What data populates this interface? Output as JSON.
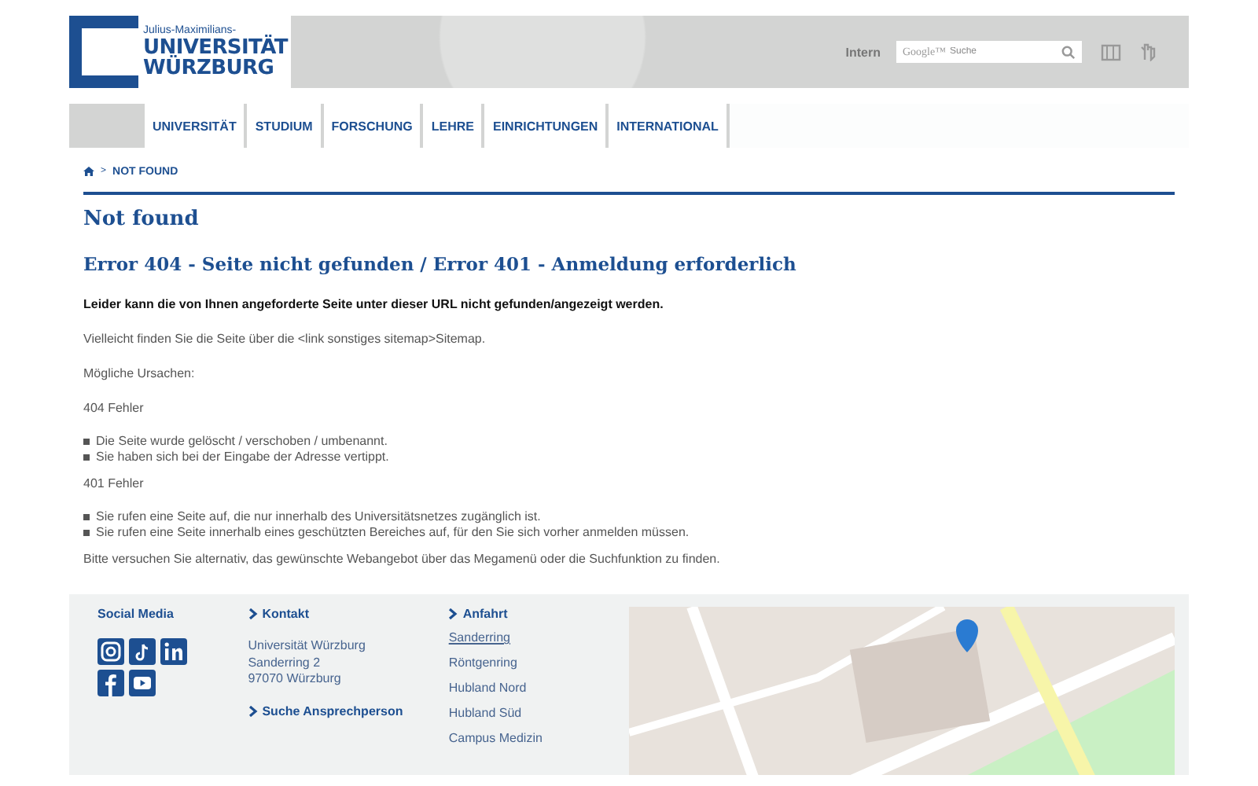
{
  "header": {
    "logo": {
      "small": "Julius-Maximilians-",
      "line1": "UNIVERSITÄT",
      "line2": "WÜRZBURG"
    },
    "intern": "Intern",
    "search": {
      "brand": "Google™",
      "placeholder": "Suche"
    }
  },
  "nav": [
    "UNIVERSITÄT",
    "STUDIUM",
    "FORSCHUNG",
    "LEHRE",
    "EINRICHTUNGEN",
    "INTERNATIONAL"
  ],
  "breadcrumb": [
    {
      "separator": ">",
      "label": "NOT FOUND"
    }
  ],
  "title": "Not found",
  "subtitle": "Error 404 - Seite nicht gefunden / Error 401 - Anmeldung erforderlich",
  "content": [
    {
      "kind": "bold",
      "text": "Leider kann die von Ihnen angeforderte Seite unter dieser URL nicht gefunden/angezeigt werden."
    },
    {
      "kind": "para",
      "text": "Vielleicht finden Sie die Seite über die <link sonstiges sitemap>Sitemap."
    },
    {
      "kind": "para",
      "text": "Mögliche Ursachen:"
    },
    {
      "kind": "para",
      "text": "404 Fehler"
    },
    {
      "kind": "list",
      "items": [
        "Die Seite wurde gelöscht / verschoben / umbenannt.",
        "Sie haben sich bei der Eingabe der Adresse vertippt."
      ]
    },
    {
      "kind": "para",
      "text": "401 Fehler"
    },
    {
      "kind": "list",
      "items": [
        "Sie rufen eine Seite auf, die nur innerhalb des Universitätsnetzes zugänglich ist.",
        "Sie rufen eine Seite innerhalb eines geschützten Bereiches auf, für den Sie sich vorher anmelden müssen."
      ]
    },
    {
      "kind": "para",
      "text": "Bitte versuchen Sie alternativ, das gewünschte Webangebot über das Megamenü oder die Suchfunktion zu finden."
    }
  ],
  "footer": {
    "social": {
      "title": "Social Media",
      "icons": [
        {
          "kind": "instagram"
        },
        {
          "kind": "tiktok"
        },
        {
          "kind": "linkedin"
        },
        {
          "kind": "facebook"
        },
        {
          "kind": "youtube"
        }
      ]
    },
    "contact": {
      "title": "Kontakt",
      "address": [
        "Universität Würzburg",
        "Sanderring 2",
        "97070 Würzburg"
      ],
      "link": "Suche Ansprechperson"
    },
    "directions": {
      "title": "Anfahrt",
      "items": [
        {
          "label": "Sanderring",
          "selected": true
        },
        {
          "label": "Röntgenring",
          "selected": false
        },
        {
          "label": "Hubland Nord",
          "selected": false
        },
        {
          "label": "Hubland Süd",
          "selected": false
        },
        {
          "label": "Campus Medizin",
          "selected": false
        }
      ]
    }
  }
}
